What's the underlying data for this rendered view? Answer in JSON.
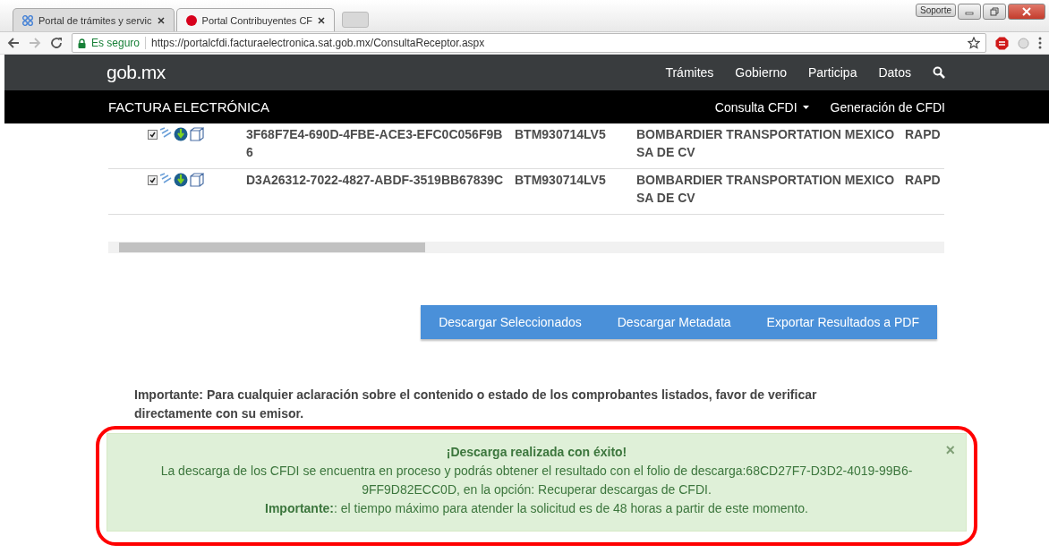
{
  "browser": {
    "tabs": [
      {
        "title": "Portal de trámites y servic",
        "selected": false
      },
      {
        "title": "Portal Contribuyentes CF",
        "selected": true
      }
    ],
    "window_buttons": {
      "support": "Soporte"
    },
    "address_bar": {
      "security": "Es seguro",
      "url": "https://portalcfdi.facturaelectronica.sat.gob.mx/ConsultaReceptor.aspx"
    }
  },
  "site_header": {
    "logo": "gob.mx",
    "nav": [
      "Trámites",
      "Gobierno",
      "Participa",
      "Datos"
    ]
  },
  "sub_header": {
    "title": "FACTURA ELECTRÓNICA",
    "menu": [
      {
        "label": "Consulta CFDI",
        "dropdown": true
      },
      {
        "label": "Generación de CFDI",
        "dropdown": false
      }
    ]
  },
  "table": {
    "rows": [
      {
        "selected": true,
        "folio": "3F68F7E4-690D-4FBE-ACE3-EFC0C056F9B6",
        "rfc": "BTM930714LV5",
        "name": "BOMBARDIER TRANSPORTATION MEXICO SA DE CV",
        "column_4": "RAPD"
      },
      {
        "selected": true,
        "folio": "D3A26312-7022-4827-ABDF-3519BB67839C",
        "rfc": "BTM930714LV5",
        "name": "BOMBARDIER TRANSPORTATION MEXICO SA DE CV",
        "column_4": "RAPD"
      }
    ]
  },
  "actions": [
    "Descargar Seleccionados",
    "Descargar Metadata",
    "Exportar Resultados a PDF"
  ],
  "notice": "Importante: Para cualquier aclaración sobre el contenido o estado de los comprobantes listados, favor de verificar directamente con su emisor.",
  "alert": {
    "title": "¡Descarga realizada con éxito!",
    "close": "×",
    "message": "La descarga de los CFDI se encuentra en proceso y podrás obtener el resultado con el folio de descarga:68CD27F7-D3D2-4019-99B6-9FF9D82ECC0D, en la opción: Recuperar descargas de CFDI.",
    "note": "**Importante:**: el tiempo máximo para atender la solicitud es de 48 horas a partir de este momento.",
    "highlighted": true
  }
}
